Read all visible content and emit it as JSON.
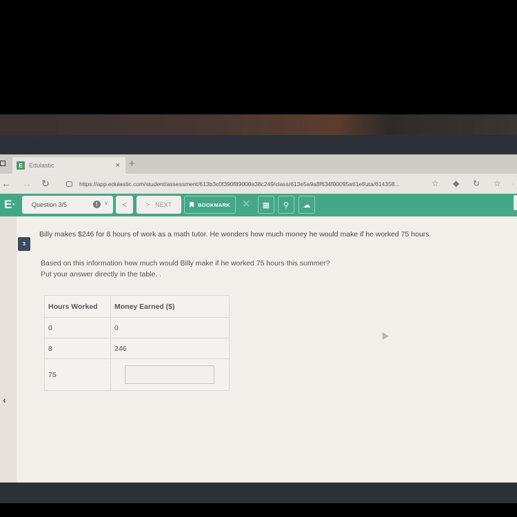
{
  "browser": {
    "tab_title": "Edulastic",
    "tab_favicon": "E",
    "close_tab": "×",
    "new_tab": "+",
    "url": "https://app.edulastic.com/student/assessment/613b3c0f390f89000a38c249/class/613e5a9a8f634f00095a61ef/uta/614358...",
    "icons": [
      "back-icon",
      "forward-icon",
      "refresh-icon",
      "lock-icon",
      "reading-view-icon",
      "extensions-icon",
      "sync-icon",
      "favorites-icon"
    ]
  },
  "toolbar": {
    "logo": "E·",
    "question_select": "Question 3/5",
    "info_glyph": "!",
    "prev_label": "<",
    "next_arrow": ">",
    "next_label": "NEXT",
    "bookmark_label": "BOOKMARK",
    "close_glyph": "✕",
    "tools": [
      "calculator-icon",
      "zoom-icon",
      "upload-icon"
    ],
    "accent_color": "#44a886"
  },
  "question": {
    "number": "3",
    "stem": "Billy makes $246 for 8 hours of work as a math tutor.  He wonders how much money he would make if he worked 75 hours.",
    "prompt_line1": "Based on this information how much would Billy make if he worked 75 hours this summer?",
    "prompt_line2": "Put your answer directly in the table. .",
    "table": {
      "headers": [
        "Hours Worked",
        "Money Earned ($)"
      ],
      "rows": [
        [
          "0",
          "0"
        ],
        [
          "8",
          "246"
        ],
        [
          "75",
          ""
        ]
      ],
      "answer_value": ""
    }
  }
}
